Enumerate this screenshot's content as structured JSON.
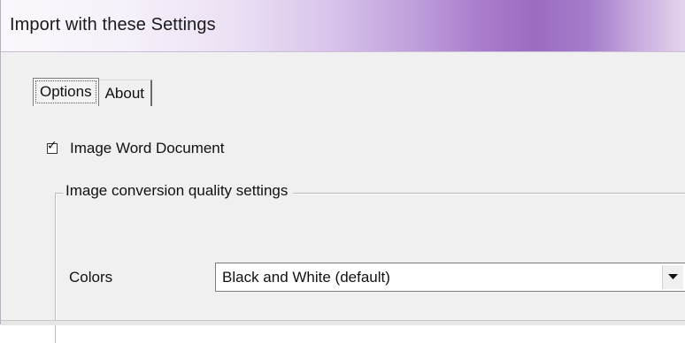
{
  "window": {
    "title": "Import with these Settings"
  },
  "tabs": [
    {
      "label": "Options",
      "active": true
    },
    {
      "label": "About",
      "active": false
    }
  ],
  "options": {
    "image_word_document": {
      "label": "Image Word Document",
      "checked": true
    },
    "group": {
      "title": "Image conversion quality settings"
    },
    "colors": {
      "label": "Colors",
      "selected": "Black and White (default)"
    }
  },
  "icons": {
    "checkbox_tick": "checkmark-icon",
    "dropdown": "chevron-down-icon"
  },
  "colors": {
    "title_gradient_accent": "#9b6cc2",
    "dialog_background": "#f0f0f0"
  }
}
